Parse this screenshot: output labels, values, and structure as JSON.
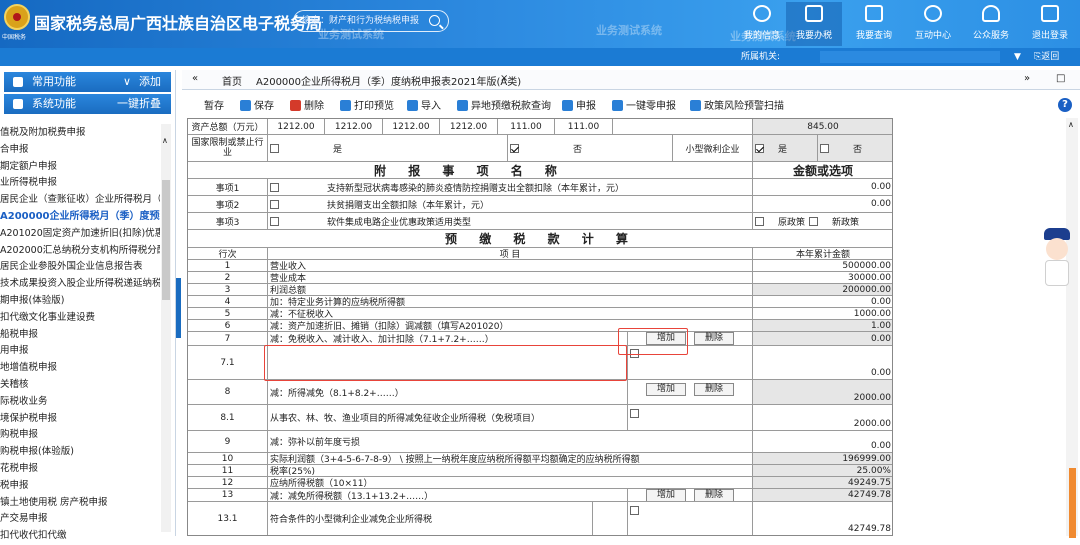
{
  "header": {
    "logo_text": "中国税务",
    "title": "国家税务总局广西壮族自治区电子税务局",
    "search_placeholder": "搜索：财产和行为税纳税申报",
    "watermarks": [
      "业务测试系统",
      "业务测试系统",
      "业务测试系统"
    ],
    "nav": [
      {
        "label": "我的信息",
        "icon": "user-icon"
      },
      {
        "label": "我要办税",
        "icon": "monitor-icon"
      },
      {
        "label": "我要查询",
        "icon": "query-icon"
      },
      {
        "label": "互动中心",
        "icon": "chat-icon"
      },
      {
        "label": "公众服务",
        "icon": "service-icon"
      },
      {
        "label": "退出登录",
        "icon": "logout-icon"
      }
    ]
  },
  "subbar": {
    "org_label": "所属机关:",
    "back": "返回"
  },
  "sidebar": {
    "common": "常用功能",
    "add": "添加",
    "system": "系统功能",
    "collapse": "一键折叠",
    "items": [
      "值税及附加税费申报",
      "合申报",
      "期定额户申报",
      "业所得税申报",
      "居民企业（查账征收）企业所得税月（",
      "A200000企业所得税月（季）度预缴纳税",
      "A201020固定资产加速折旧(扣除)优惠",
      "A202000汇总纳税分支机构所得税分配",
      "居民企业参股外国企业信息报告表",
      "技术成果投资入股企业所得税递延纳税",
      "期申报(体验版)",
      "扣代缴文化事业建设费",
      "船税申报",
      "用申报",
      "地增值税申报",
      "关稽核",
      "际税收业务",
      "境保护税申报",
      "购税申报",
      "购税申报(体验版)",
      "花税申报",
      "税申报",
      "镇土地使用税 房产税申报",
      "产交易申报",
      "扣代收代扣代缴"
    ]
  },
  "tabs": {
    "home": "首页",
    "active": "A200000企业所得税月（季）度纳税申报表2021年版(A类)"
  },
  "toolbar": [
    {
      "label": "暂存",
      "icon": "none"
    },
    {
      "label": "保存",
      "icon": "save-icon"
    },
    {
      "label": "删除",
      "icon": "delete-icon"
    },
    {
      "label": "打印预览",
      "icon": "print-icon"
    },
    {
      "label": "导入",
      "icon": "import-icon"
    },
    {
      "label": "异地预缴税款查询",
      "icon": "query-icon"
    },
    {
      "label": "申报",
      "icon": "declare-icon"
    },
    {
      "label": "一键零申报",
      "icon": "zero-icon"
    },
    {
      "label": "政策风险预警扫描",
      "icon": "scan-icon"
    }
  ],
  "form": {
    "asset_label": "资产总额（万元）",
    "assets": [
      "1212.00",
      "1212.00",
      "1212.00",
      "1212.00",
      "111.00",
      "111.00"
    ],
    "asset_avg": "845.00",
    "restricted_label": "国家限制或禁止行业",
    "yes": "是",
    "no": "否",
    "small_label": "小型微利企业",
    "attached_title": "附 报 事 项 名 称",
    "amount_title": "金额或选项",
    "matters": [
      {
        "no": "事项1",
        "name": "支持新型冠状病毒感染的肺炎疫情防控捐赠支出全额扣除（本年累计，元）",
        "val": "0.00"
      },
      {
        "no": "事项2",
        "name": "扶贫捐赠支出全额扣除（本年累计，元）",
        "val": "0.00"
      },
      {
        "no": "事项3",
        "name": "软件集成电路企业优惠政策适用类型",
        "opt1": "原政策",
        "opt2": "新政策"
      }
    ],
    "calc_title": "预 缴 税 款 计 算",
    "col_no": "行次",
    "col_item": "项 目",
    "col_amt": "本年累计金额",
    "add_btn": "增加",
    "del_btn": "删除",
    "rows": [
      {
        "no": "1",
        "item": "营业收入",
        "amt": "500000.00"
      },
      {
        "no": "2",
        "item": "营业成本",
        "amt": "30000.00"
      },
      {
        "no": "3",
        "item": "利润总额",
        "amt": "200000.00"
      },
      {
        "no": "4",
        "item": "加：特定业务计算的应纳税所得额",
        "amt": "0.00"
      },
      {
        "no": "5",
        "item": "减：不征税收入",
        "amt": "1000.00"
      },
      {
        "no": "6",
        "item": "减：资产加速折旧、摊销（扣除）调减额（填写A201020）",
        "amt": "1.00"
      },
      {
        "no": "7",
        "item": "减：免税收入、减计收入、加计扣除（7.1+7.2+……）",
        "amt": "0.00"
      },
      {
        "no": "7.1",
        "item": "",
        "amt": "0.00"
      },
      {
        "no": "8",
        "item": "减：所得减免（8.1+8.2+……）",
        "amt": "2000.00"
      },
      {
        "no": "8.1",
        "item": "从事农、林、牧、渔业项目的所得减免征收企业所得税（免税项目）",
        "amt": "2000.00"
      },
      {
        "no": "9",
        "item": "减：弥补以前年度亏损",
        "amt": "0.00"
      },
      {
        "no": "10",
        "item": "实际利润额（3+4-5-6-7-8-9） \\ 按照上一纳税年度应纳税所得额平均额确定的应纳税所得额",
        "amt": "196999.00"
      },
      {
        "no": "11",
        "item": "税率(25%)",
        "amt": "25.00%"
      },
      {
        "no": "12",
        "item": "应纳所得税额（10×11）",
        "amt": "49249.75"
      },
      {
        "no": "13",
        "item": "减：减免所得税额（13.1+13.2+……）",
        "amt": "42749.78"
      },
      {
        "no": "13.1",
        "item": "符合条件的小型微利企业减免企业所得税",
        "amt": "42749.78"
      }
    ]
  }
}
